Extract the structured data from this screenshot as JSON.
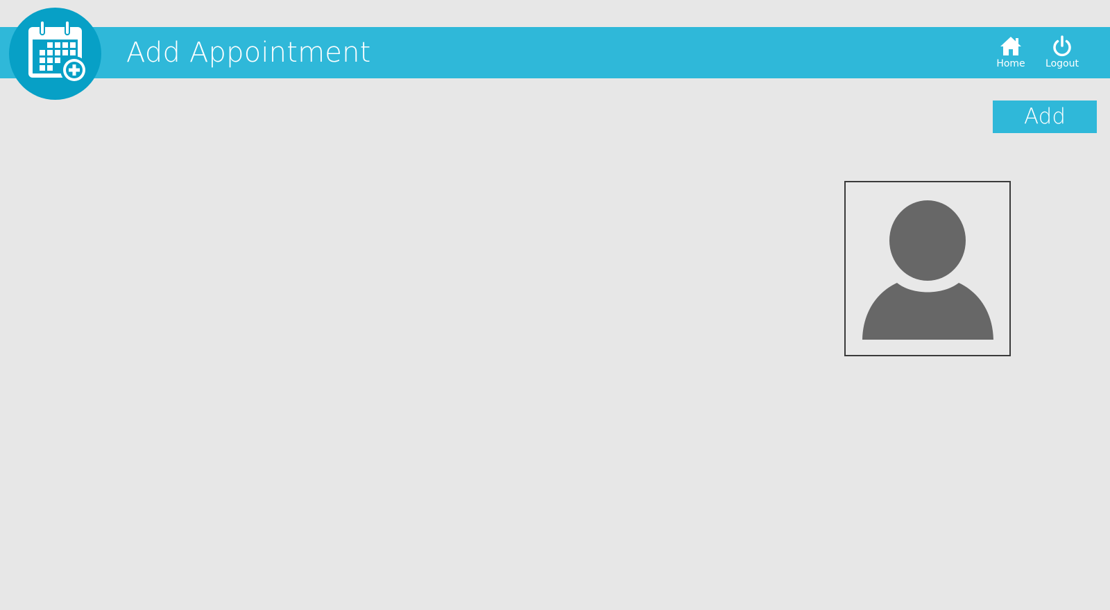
{
  "app": {
    "logo_icon": "calendar-add-icon",
    "accent_color": "#2fb8d9",
    "logo_color": "#07a0c6"
  },
  "header": {
    "title": "Add Appointment",
    "nav": {
      "home": {
        "label": "Home",
        "icon": "home-icon"
      },
      "logout": {
        "label": "Logout",
        "icon": "power-icon"
      }
    }
  },
  "main": {
    "add_label": "Add",
    "photo": {
      "icon": "user-silhouette-icon"
    }
  }
}
